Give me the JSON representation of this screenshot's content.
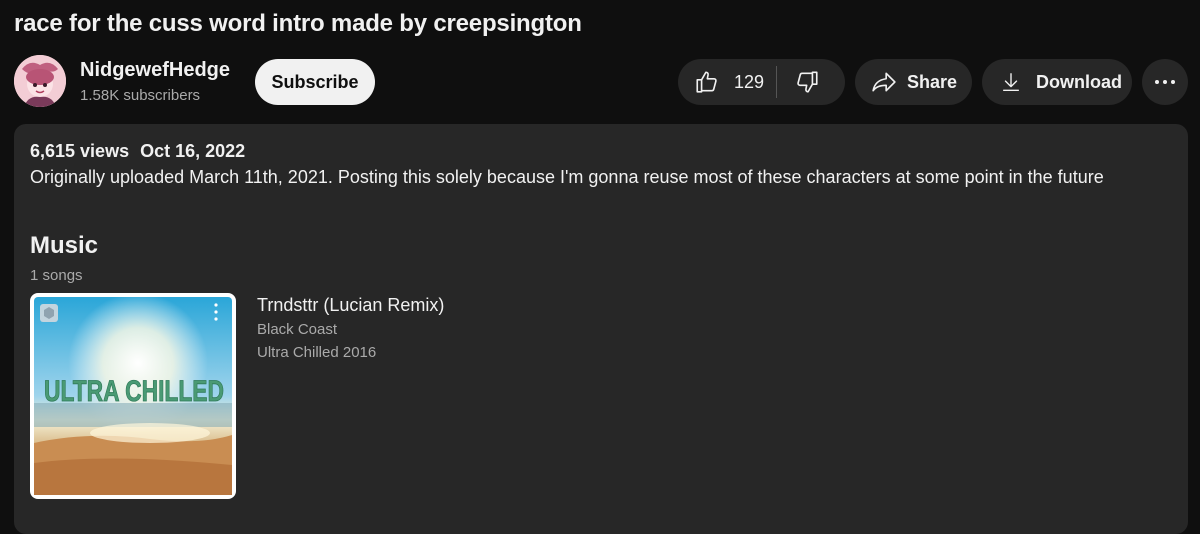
{
  "video": {
    "title": "race for the cuss word intro made by creepsington"
  },
  "channel": {
    "name": "NidgewefHedge",
    "subscribers": "1.58K subscribers",
    "subscribe_label": "Subscribe"
  },
  "actions": {
    "like_count": "129",
    "share_label": "Share",
    "download_label": "Download",
    "like_icon": "thumbs-up-icon",
    "dislike_icon": "thumbs-down-icon",
    "share_icon": "share-arrow-icon",
    "download_icon": "download-icon",
    "more_icon": "more-horizontal-icon"
  },
  "description": {
    "views": "6,615 views",
    "date": "Oct 16, 2022",
    "text": "Originally uploaded March 11th, 2021. Posting this solely because I'm gonna reuse most of these characters at some point in the future"
  },
  "music": {
    "heading": "Music",
    "count": "1 songs",
    "songs": [
      {
        "title": "Trndsttr (Lucian Remix)",
        "artist": "Black Coast",
        "album": "Ultra Chilled 2016",
        "cover_text": "ULTRA CHILLED"
      }
    ]
  },
  "colors": {
    "background": "#0f0f0f",
    "surface": "#272727",
    "text_primary": "#f1f1f1",
    "text_secondary": "#aaaaaa",
    "subscribe_bg": "#f1f1f1"
  }
}
